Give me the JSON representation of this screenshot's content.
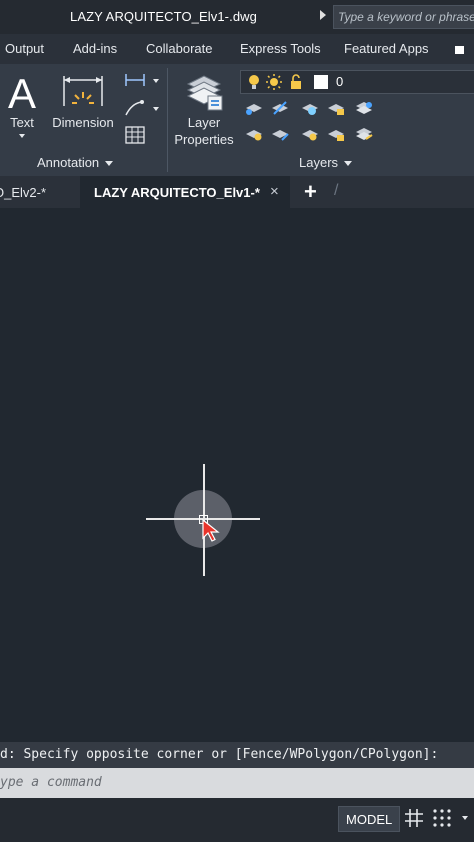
{
  "titlebar": {
    "document_title": "LAZY ARQUITECTO_Elv1-.dwg",
    "search_placeholder": "Type a keyword or phrase"
  },
  "ribbon_tabs": [
    "Output",
    "Add-ins",
    "Collaborate",
    "Express Tools",
    "Featured Apps"
  ],
  "panels": {
    "annotation": {
      "title": "Annotation",
      "text_label": "Text",
      "dimension_label": "Dimension"
    },
    "layers": {
      "title": "Layers",
      "properties_label_line1": "Layer",
      "properties_label_line2": "Properties",
      "current_layer": "0"
    }
  },
  "file_tabs": {
    "inactive_label": "O_Elv2-*",
    "active_label": "LAZY ARQUITECTO_Elv1-*",
    "close_symbol": "×",
    "add_symbol": "+"
  },
  "command": {
    "history_text": "d: Specify opposite corner or [Fence/WPolygon/CPolygon]:",
    "input_placeholder": "ype a command"
  },
  "statusbar": {
    "model_label": "MODEL"
  },
  "colors": {
    "canvas": "#212830",
    "ribbon": "#343c47",
    "cursor_red": "#e8332a"
  }
}
